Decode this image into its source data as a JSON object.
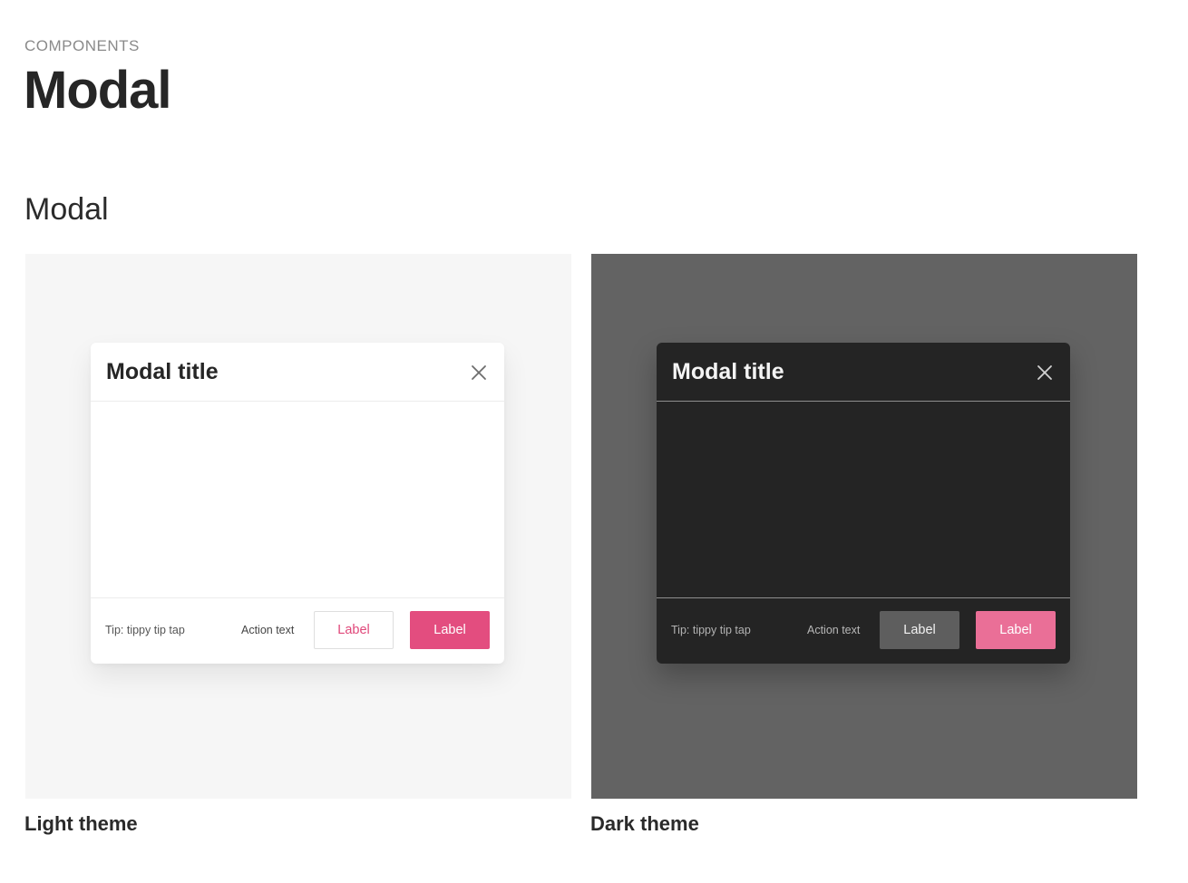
{
  "header": {
    "eyebrow": "COMPONENTS",
    "title": "Modal"
  },
  "section": {
    "title": "Modal"
  },
  "previews": [
    {
      "theme": "light",
      "caption": "Light theme",
      "colors": {
        "background": "#f6f6f6",
        "modal": "#ffffff",
        "accent": "#e34d7f"
      },
      "modal": {
        "title": "Modal title",
        "close_icon": "close-icon",
        "tip": "Tip: tippy tip tap",
        "action_text": "Action text",
        "secondary_label": "Label",
        "primary_label": "Label"
      }
    },
    {
      "theme": "dark",
      "caption": "Dark theme",
      "colors": {
        "background": "#636363",
        "modal": "#242424",
        "accent": "#ea6f97"
      },
      "modal": {
        "title": "Modal title",
        "close_icon": "close-icon",
        "tip": "Tip: tippy tip tap",
        "action_text": "Action text",
        "secondary_label": "Label",
        "primary_label": "Label"
      }
    }
  ]
}
